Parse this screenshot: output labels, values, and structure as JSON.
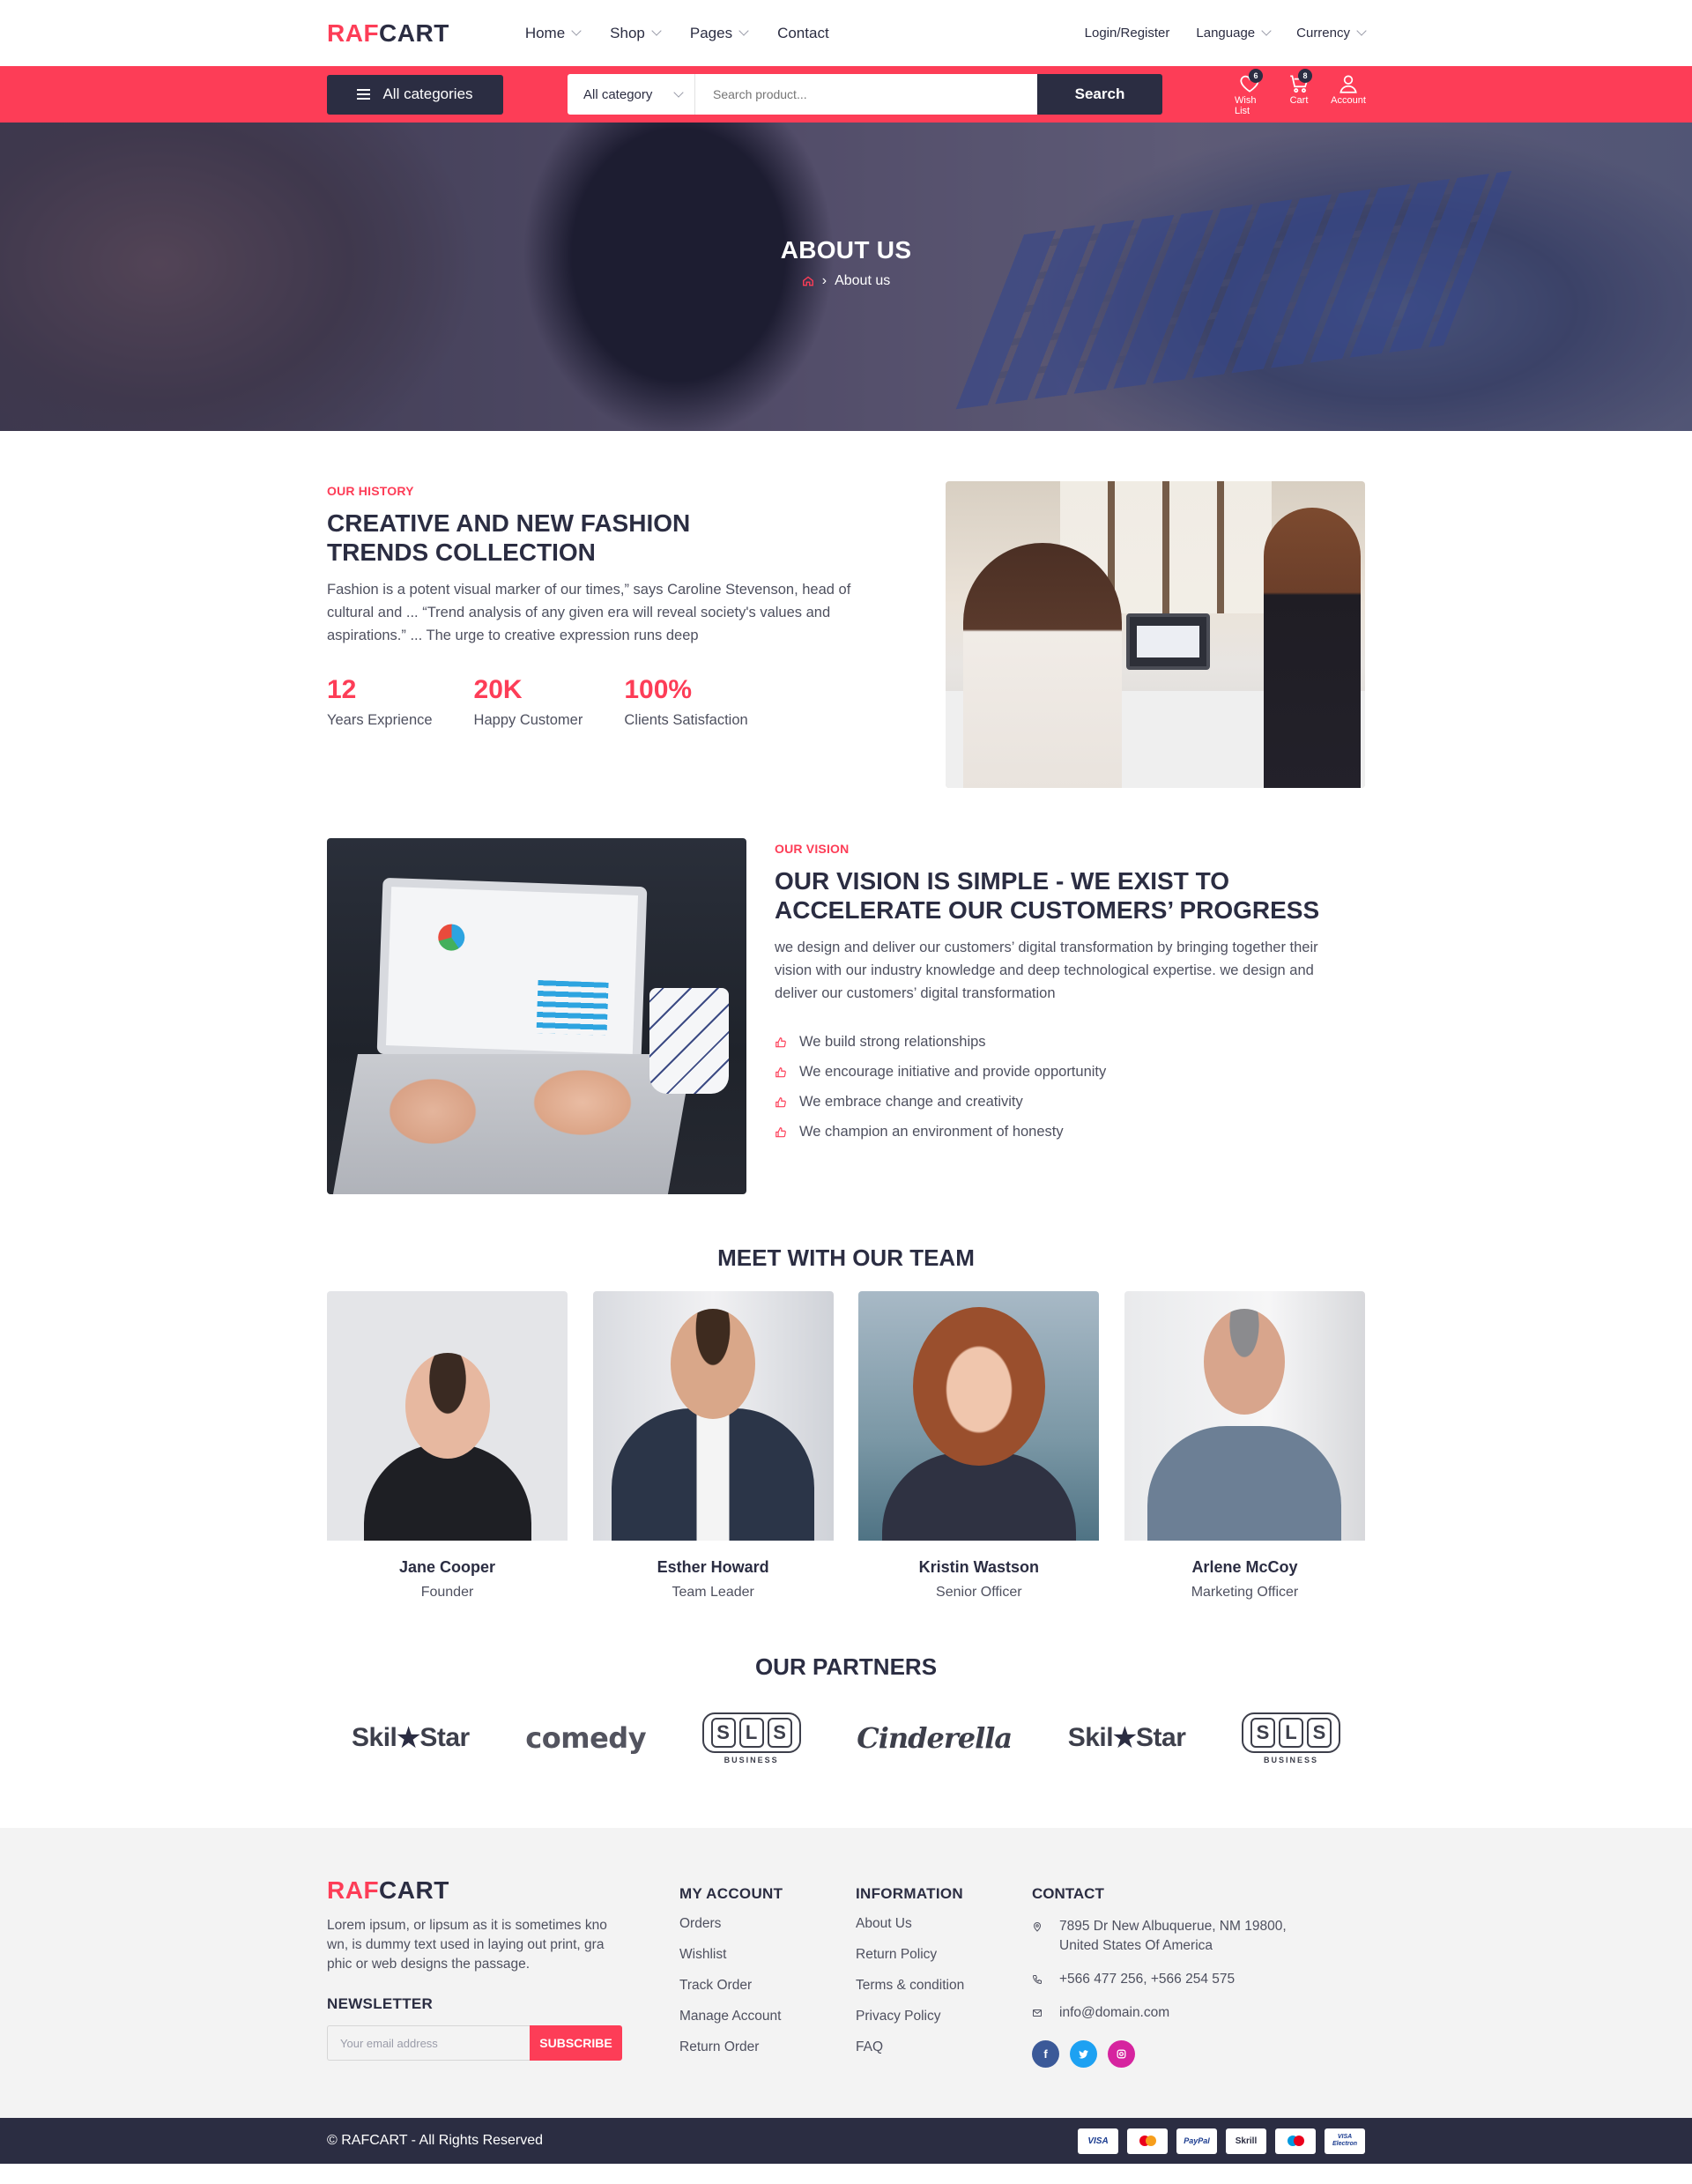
{
  "header": {
    "logo_red": "RAF",
    "logo_dark": "CART",
    "nav": [
      "Home",
      "Shop",
      "Pages",
      "Contact"
    ],
    "login": "Login/Register",
    "language": "Language",
    "currency": "Currency"
  },
  "searchbar": {
    "all_categories": "All categories",
    "category_select": "All category",
    "placeholder": "Search product...",
    "search_button": "Search",
    "wishlist_label": "Wish List",
    "wishlist_count": "6",
    "cart_label": "Cart",
    "cart_count": "8",
    "account_label": "Account"
  },
  "banner": {
    "title": "ABOUT US",
    "breadcrumb_current": "About us"
  },
  "history": {
    "eyebrow": "OUR HISTORY",
    "title_line1": "CREATIVE AND NEW FASHION",
    "title_line2": "TRENDS COLLECTION",
    "text": "Fashion is a potent visual marker of our times,” says Caroline Stevenson, head of cultural and ... “Trend analysis of any given era will reveal society's values and aspirations.” ... The urge to creative expression runs deep",
    "stats": [
      {
        "value": "12",
        "label": "Years Exprience"
      },
      {
        "value": "20K",
        "label": "Happy Customer"
      },
      {
        "value": "100%",
        "label": "Clients Satisfaction"
      }
    ]
  },
  "vision": {
    "eyebrow": "OUR VISION",
    "title_line1": "OUR VISION IS SIMPLE - WE EXIST TO",
    "title_line2": "ACCELERATE OUR CUSTOMERS’ PROGRESS",
    "text": "we design and deliver our customers’ digital transformation by bringing together their vision with our industry knowledge and deep technological expertise. we design and deliver our customers’ digital transformation",
    "points": [
      "We build strong relationships",
      "We encourage initiative and provide opportunity",
      "We embrace change and creativity",
      "We champion an environment of honesty"
    ]
  },
  "team": {
    "title": "MEET WITH OUR TEAM",
    "members": [
      {
        "name": "Jane Cooper",
        "role": "Founder"
      },
      {
        "name": "Esther Howard",
        "role": "Team Leader"
      },
      {
        "name": "Kristin Wastson",
        "role": "Senior Officer"
      },
      {
        "name": "Arlene McCoy",
        "role": "Marketing Officer"
      }
    ]
  },
  "partners": {
    "title": "OUR PARTNERS",
    "logos": [
      "Skil",
      "Star",
      "comedy",
      "S",
      "L",
      "S",
      "BUSINESS",
      "Cinderella"
    ]
  },
  "footer": {
    "logo_red": "RAF",
    "logo_dark": "CART",
    "description": "Lorem ipsum, or lipsum as it is sometimes kno wn, is dummy text used in laying out print, gra phic or web designs the passage.",
    "newsletter_title": "NEWSLETTER",
    "newsletter_placeholder": "Your email address",
    "subscribe": "SUBSCRIBE",
    "my_account_title": "MY ACCOUNT",
    "my_account": [
      "Orders",
      "Wishlist",
      "Track Order",
      "Manage Account",
      "Return Order"
    ],
    "information_title": "INFORMATION",
    "information": [
      "About Us",
      "Return Policy",
      "Terms & condition",
      "Privacy Policy",
      "FAQ"
    ],
    "contact_title": "CONTACT",
    "address": "7895 Dr New Albuquerue, NM 19800, United States Of America",
    "phone": "+566 477 256, +566 254 575",
    "email": "info@domain.com"
  },
  "bottom": {
    "copyright": "© RAFCART - All Rights Reserved",
    "payments": [
      "VISA",
      "PayPal",
      "Skrill",
      "VISA Electron"
    ]
  },
  "colors": {
    "accent": "#fd3d57",
    "dark": "#2b2d42",
    "footer_bg": "#f3f3f3"
  }
}
